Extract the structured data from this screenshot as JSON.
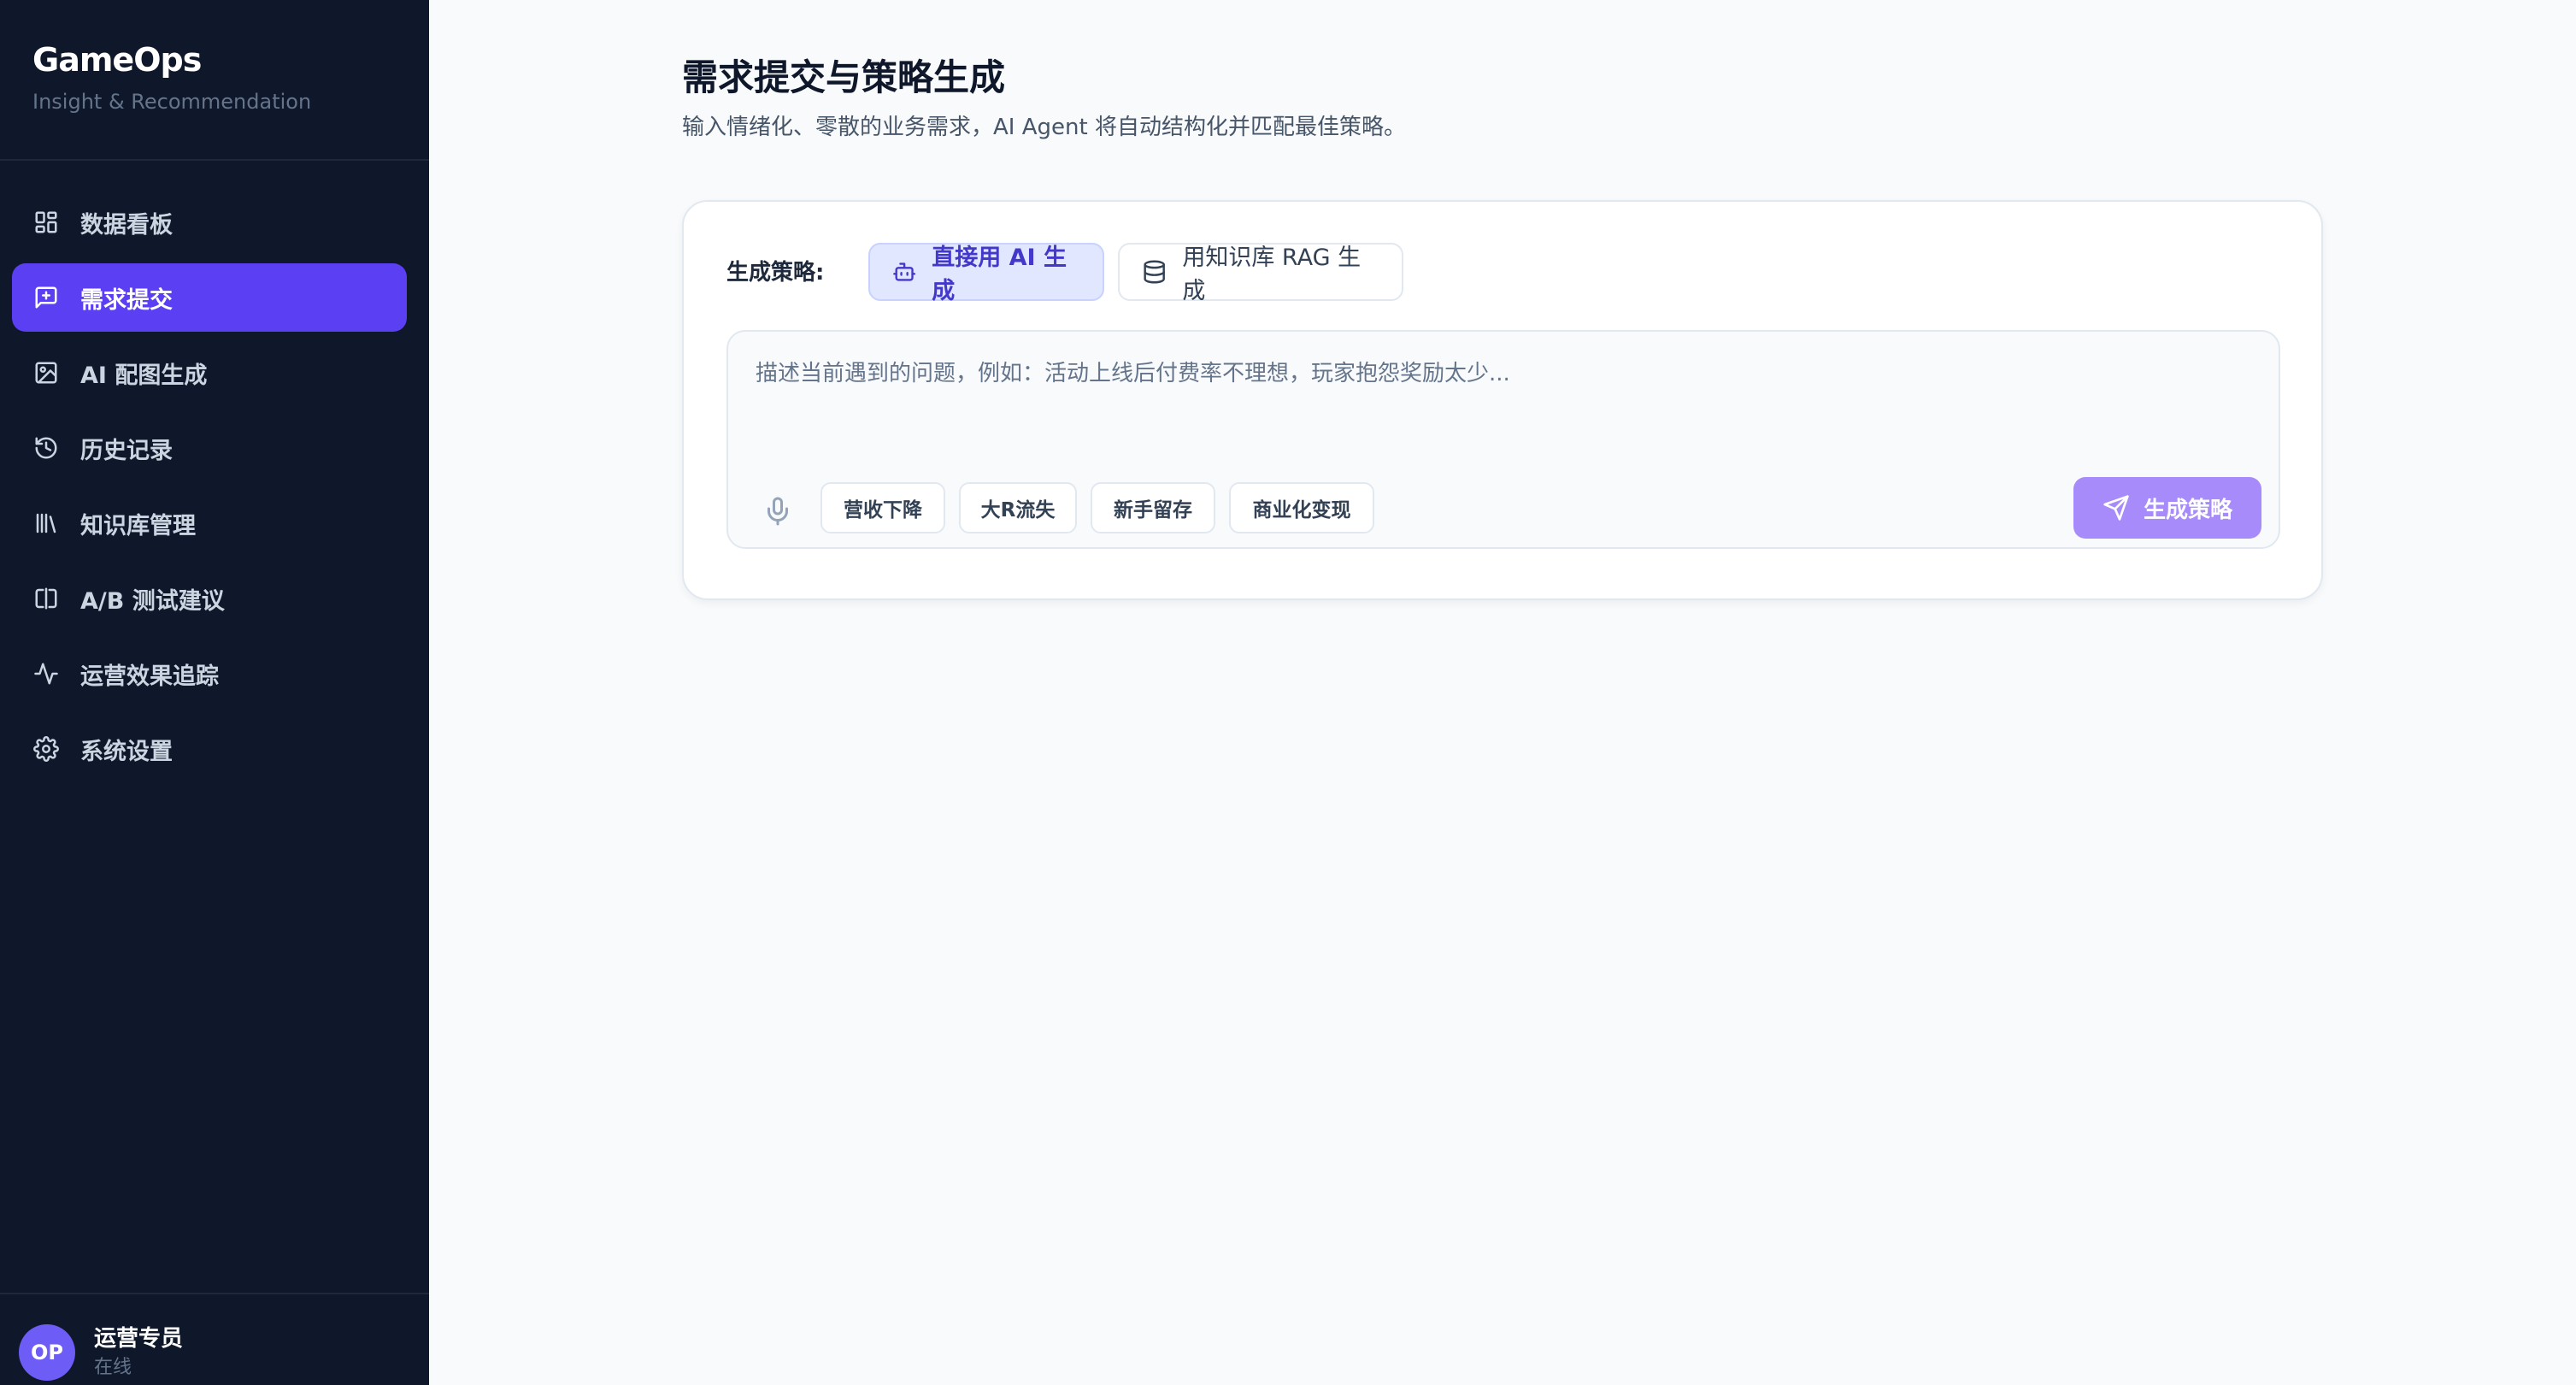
{
  "app": {
    "title": "GameOps",
    "subtitle": "Insight & Recommendation"
  },
  "sidebar": {
    "items": [
      {
        "label": "数据看板",
        "icon": "grid-icon",
        "active": false
      },
      {
        "label": "需求提交",
        "icon": "message-plus-icon",
        "active": true
      },
      {
        "label": "AI 配图生成",
        "icon": "image-icon",
        "active": false
      },
      {
        "label": "历史记录",
        "icon": "history-icon",
        "active": false
      },
      {
        "label": "知识库管理",
        "icon": "library-icon",
        "active": false
      },
      {
        "label": "A/B 测试建议",
        "icon": "split-icon",
        "active": false
      },
      {
        "label": "运营效果追踪",
        "icon": "activity-icon",
        "active": false
      },
      {
        "label": "系统设置",
        "icon": "settings-icon",
        "active": false
      }
    ]
  },
  "user": {
    "initials": "OP",
    "name": "运营专员",
    "status": "在线"
  },
  "main": {
    "title": "需求提交与策略生成",
    "subtitle": "输入情绪化、零散的业务需求，AI Agent 将自动结构化并匹配最佳策略。",
    "strategy_label": "生成策略:",
    "strategy_options": [
      {
        "label": "直接用 AI 生成",
        "icon": "bot-icon",
        "selected": true
      },
      {
        "label": "用知识库 RAG 生成",
        "icon": "database-icon",
        "selected": false
      }
    ],
    "input": {
      "placeholder": "描述当前遇到的问题，例如：活动上线后付费率不理想，玩家抱怨奖励太少...",
      "value": ""
    },
    "quick_tags": [
      "营收下降",
      "大R流失",
      "新手留存",
      "商业化变现"
    ],
    "generate_label": "生成策略"
  },
  "colors": {
    "sidebar_bg": "#0f172a",
    "accent": "#5b3ff3",
    "generate_button": "#a78bfa",
    "page_bg": "#f8fafc"
  }
}
